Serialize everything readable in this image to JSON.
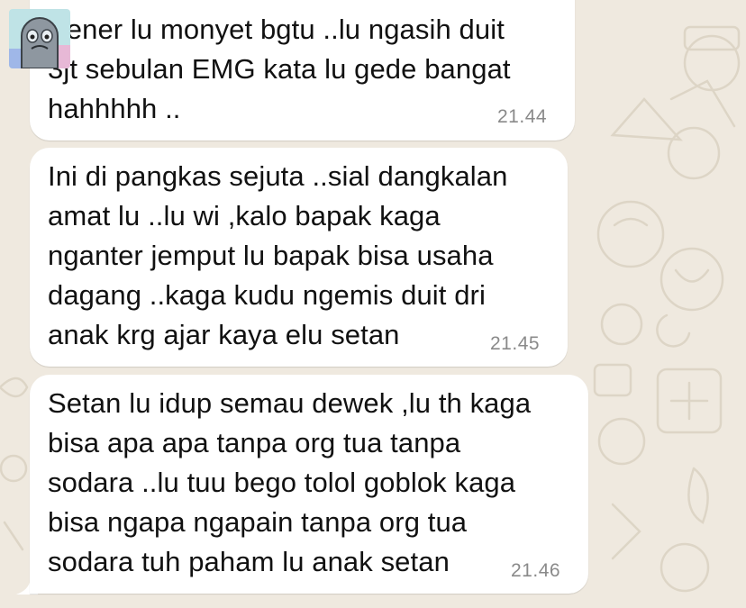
{
  "chat": {
    "messages": [
      {
        "text": "Bener lu monyet bgtu ..lu ngasih duit\n3jt sebulan EMG kata lu gede bangat\nhahhhhh ..",
        "time": "21.44"
      },
      {
        "text": "Ini di pangkas sejuta ..sial dangkalan\namat lu ..lu wi ,kalo bapak kaga\nnganter jemput lu bapak bisa usaha\ndagang ..kaga kudu ngemis duit dri\nanak krg ajar kaya elu setan",
        "time": "21.45"
      },
      {
        "text": "Setan lu idup semau dewek ,lu th kaga\nbisa apa apa tanpa org tua tanpa\nsodara ..lu tuu bego tolol goblok kaga\nbisa ngapa ngapain tanpa org tua\nsodara tuh paham lu anak setan",
        "time": "21.46"
      }
    ]
  },
  "colors": {
    "wallpaper": "#efe9df",
    "bubble": "#ffffff",
    "text": "#111111",
    "timestamp": "#8a8a8a"
  },
  "icons": {
    "sender_avatar": "ghost-sticker-avatar"
  }
}
